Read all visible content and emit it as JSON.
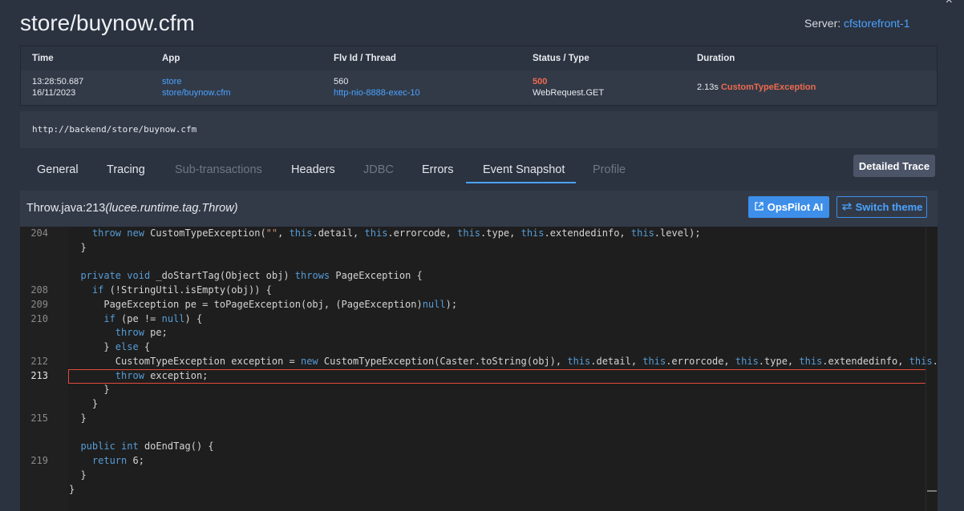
{
  "page": {
    "title": "store/buynow.cfm"
  },
  "server": {
    "label": "Server:",
    "name": "cfstorefront-1"
  },
  "summary": {
    "headers": [
      "Time",
      "App",
      "Flv Id / Thread",
      "Status / Type",
      "Duration"
    ],
    "time": "13:28:50.687",
    "date": "16/11/2023",
    "app": "store",
    "app_path": "store/buynow.cfm",
    "flv_id": "560",
    "thread": "http-nio-8888-exec-10",
    "status": "500",
    "type": "WebRequest.GET",
    "duration": "2.13s",
    "exception": "CustomTypeException"
  },
  "url": "http://backend/store/buynow.cfm",
  "tabs": [
    {
      "label": "General",
      "disabled": false
    },
    {
      "label": "Tracing",
      "disabled": false
    },
    {
      "label": "Sub-transactions",
      "disabled": true
    },
    {
      "label": "Headers",
      "disabled": false
    },
    {
      "label": "JDBC",
      "disabled": true
    },
    {
      "label": "Errors",
      "disabled": false
    },
    {
      "label": "Event Snapshot",
      "disabled": false,
      "active": true
    },
    {
      "label": "Profile",
      "disabled": true
    }
  ],
  "detailed_trace_label": "Detailed Trace",
  "frame": {
    "location": "Throw.java:213",
    "class_name": "(lucee.runtime.tag.Throw)",
    "opspilot_label": "OpsPilot AI",
    "switch_theme_label": "Switch theme"
  },
  "code_lines": [
    {
      "n": "204",
      "text": "    throw new CustomTypeException(\"\", this.detail, this.errorcode, this.type, this.extendedinfo, this.level);"
    },
    {
      "n": "",
      "text": "  }"
    },
    {
      "n": "",
      "text": ""
    },
    {
      "n": "",
      "text": "  private void _doStartTag(Object obj) throws PageException {"
    },
    {
      "n": "208",
      "text": "    if (!StringUtil.isEmpty(obj)) {"
    },
    {
      "n": "209",
      "text": "      PageException pe = toPageException(obj, (PageException)null);"
    },
    {
      "n": "210",
      "text": "      if (pe != null) {"
    },
    {
      "n": "",
      "text": "        throw pe;"
    },
    {
      "n": "",
      "text": "      } else {"
    },
    {
      "n": "212",
      "text": "        CustomTypeException exception = new CustomTypeException(Caster.toString(obj), this.detail, this.errorcode, this.type, this.extendedinfo, this.l"
    },
    {
      "n": "213",
      "text": "        throw exception;"
    },
    {
      "n": "",
      "text": "      }"
    },
    {
      "n": "",
      "text": "    }"
    },
    {
      "n": "215",
      "text": "  }"
    },
    {
      "n": "",
      "text": ""
    },
    {
      "n": "",
      "text": "  public int doEndTag() {"
    },
    {
      "n": "219",
      "text": "    return 6;"
    },
    {
      "n": "",
      "text": "  }"
    },
    {
      "n": "",
      "text": "}"
    }
  ],
  "highlight_line": "213",
  "colors": {
    "accent": "#4aa3ff",
    "error": "#ef6a4c",
    "highlight_border": "#e24a3b"
  }
}
